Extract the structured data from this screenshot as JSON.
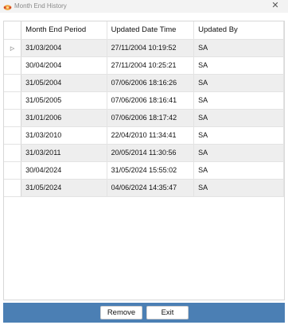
{
  "window": {
    "title": "Month End History",
    "close_glyph": "✕"
  },
  "grid": {
    "columns": [
      "Month End Period",
      "Updated Date Time",
      "Updated By"
    ],
    "current_row_marker": "▷",
    "rows": [
      [
        "31/03/2004",
        "27/11/2004 10:19:52",
        "SA"
      ],
      [
        "30/04/2004",
        "27/11/2004 10:25:21",
        "SA"
      ],
      [
        "31/05/2004",
        "07/06/2006 18:16:26",
        "SA"
      ],
      [
        "31/05/2005",
        "07/06/2006 18:16:41",
        "SA"
      ],
      [
        "31/01/2006",
        "07/06/2006 18:17:42",
        "SA"
      ],
      [
        "31/03/2010",
        "22/04/2010 11:34:41",
        "SA"
      ],
      [
        "31/03/2011",
        "20/05/2014 11:30:56",
        "SA"
      ],
      [
        "30/04/2024",
        "31/05/2024 15:55:02",
        "SA"
      ],
      [
        "31/05/2024",
        "04/06/2024 14:35:47",
        "SA"
      ]
    ]
  },
  "buttons": {
    "remove": "Remove",
    "exit": "Exit"
  },
  "colors": {
    "bottom_bar": "#4b7fb4",
    "alt_row": "#eeeeee"
  },
  "icons": {
    "app": "app-logo-icon",
    "close": "close-icon",
    "row_marker": "current-row-arrow-icon"
  }
}
